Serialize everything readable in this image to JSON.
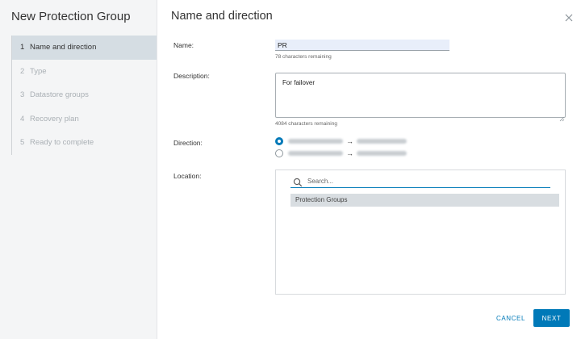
{
  "sidebar": {
    "title": "New Protection Group",
    "steps": [
      {
        "num": "1",
        "label": "Name and direction"
      },
      {
        "num": "2",
        "label": "Type"
      },
      {
        "num": "3",
        "label": "Datastore groups"
      },
      {
        "num": "4",
        "label": "Recovery plan"
      },
      {
        "num": "5",
        "label": "Ready to complete"
      }
    ]
  },
  "main": {
    "title": "Name and direction",
    "close_icon": "close-icon"
  },
  "form": {
    "name_label": "Name:",
    "name_value": "PR",
    "name_helper": "78 characters remaining",
    "description_label": "Description:",
    "description_value": "For failover",
    "description_helper": "4084 characters remaining",
    "direction_label": "Direction:",
    "direction_arrow": "→",
    "location_label": "Location:",
    "search_placeholder": "Search...",
    "location_item": "Protection Groups"
  },
  "footer": {
    "cancel_label": "CANCEL",
    "next_label": "NEXT"
  },
  "colors": {
    "accent": "#0079b8",
    "sidebar_bg": "#f4f5f6",
    "active_step_bg": "#d5dde3"
  }
}
